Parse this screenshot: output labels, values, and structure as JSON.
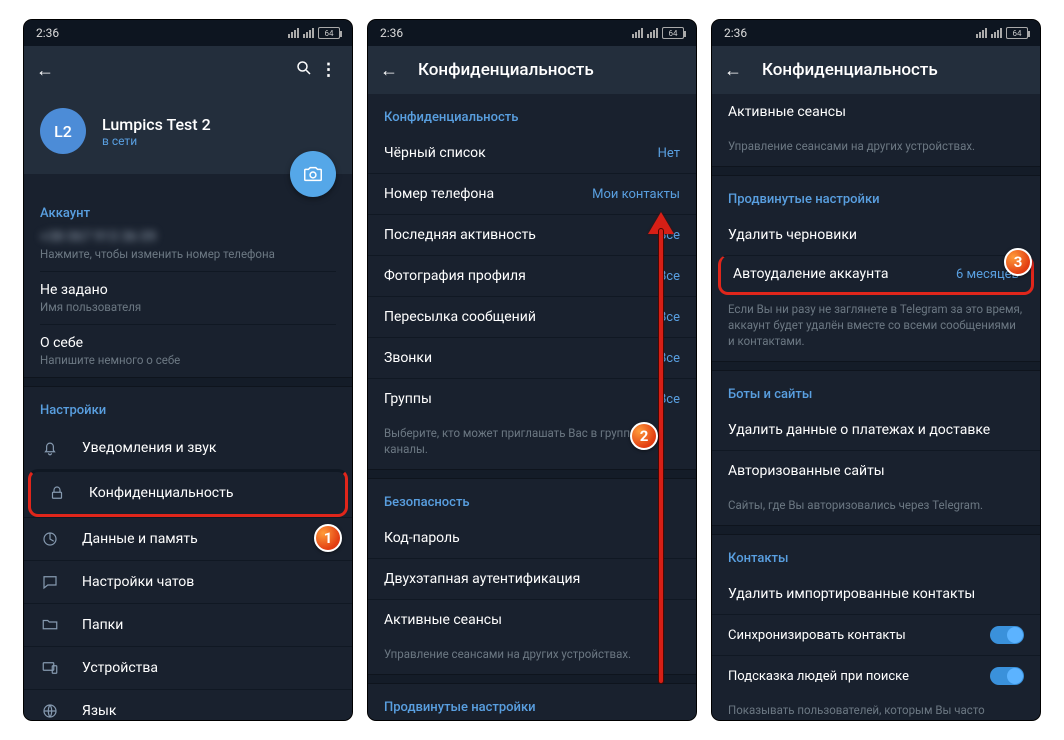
{
  "status": {
    "time": "2:36",
    "battery": "64"
  },
  "badges": {
    "b1": "1",
    "b2": "2",
    "b3": "3"
  },
  "panel1": {
    "profile": {
      "initials": "L2",
      "name": "Lumpics Test 2",
      "status": "в сети"
    },
    "account": {
      "header": "Аккаунт",
      "phone_hidden": "+38 067 913 36 09",
      "phone_hint": "Нажмите, чтобы изменить номер телефона",
      "username_value": "Не задано",
      "username_hint": "Имя пользователя",
      "bio_value": "О себе",
      "bio_hint": "Напишите немного о себе"
    },
    "settings": {
      "header": "Настройки",
      "items": {
        "notifications": "Уведомления и звук",
        "privacy": "Конфиденциальность",
        "data": "Данные и память",
        "chat": "Настройки чатов",
        "folders": "Папки",
        "devices": "Устройства",
        "language": "Язык"
      }
    }
  },
  "panel2": {
    "title": "Конфиденциальность",
    "privacy": {
      "header": "Конфиденциальность",
      "blocklist": {
        "label": "Чёрный список",
        "value": "Нет"
      },
      "phone": {
        "label": "Номер телефона",
        "value": "Мои контакты"
      },
      "lastseen": {
        "label": "Последняя активность",
        "value": "Все"
      },
      "photo": {
        "label": "Фотография профиля",
        "value": "Все"
      },
      "forward": {
        "label": "Пересылка сообщений",
        "value": "Все"
      },
      "calls": {
        "label": "Звонки",
        "value": "Все"
      },
      "groups": {
        "label": "Группы",
        "value": "Все"
      },
      "hint": "Выберите, кто может приглашать Вас в группы и каналы."
    },
    "security": {
      "header": "Безопасность",
      "code": "Код-пароль",
      "twostep": "Двухэтапная аутентификация",
      "sessions": "Активные сеансы",
      "hint": "Управление сеансами на других устройствах."
    },
    "advanced": {
      "header": "Продвинутые настройки"
    }
  },
  "panel3": {
    "title": "Конфиденциальность",
    "sessions": {
      "label": "Активные сеансы",
      "hint": "Управление сеансами на других устройствах."
    },
    "advanced": {
      "header": "Продвинутые настройки",
      "drafts": "Удалить черновики",
      "autodelete": {
        "label": "Автоудаление аккаунта",
        "value": "6 месяцев"
      },
      "hint": "Если Вы ни разу не заглянете в Telegram за это время, аккаунт будет удалён вместе со всеми сообщениями и контактами."
    },
    "bots": {
      "header": "Боты и сайты",
      "payments": "Удалить данные о платежах и доставке",
      "sites": "Авторизованные сайты",
      "hint": "Сайты, где Вы авторизовались через Telegram."
    },
    "contacts": {
      "header": "Контакты",
      "delete": "Удалить импортированные контакты",
      "sync": "Синхронизировать контакты",
      "suggest": "Подсказка людей при поиске",
      "hint": "Показывать пользователей, которым Вы часто пишете, вверху в разделе поиска."
    }
  }
}
